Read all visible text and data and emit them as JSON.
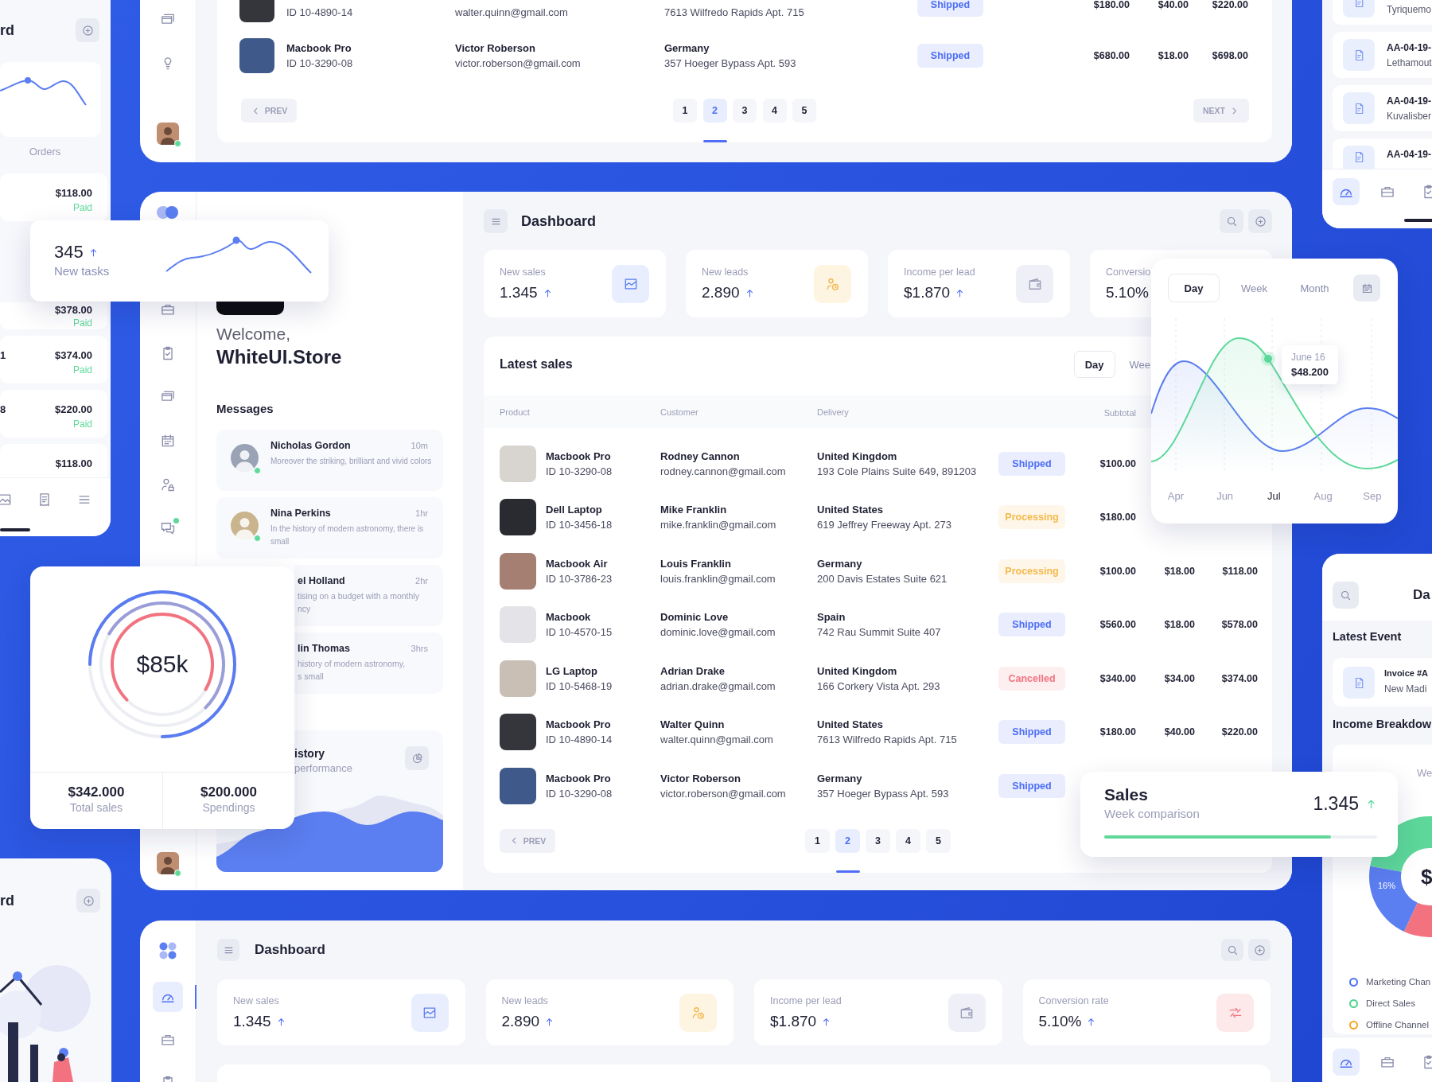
{
  "orders_card": {
    "title": "rd",
    "chart_label": "Orders",
    "orders": [
      {
        "amount": "$118.00",
        "status": "Paid"
      },
      {
        "amount": "$378.00",
        "status": "Paid"
      },
      {
        "ref": "1",
        "amount": "$374.00",
        "status": "Paid"
      },
      {
        "ref": "8",
        "amount": "$220.00",
        "status": "Paid"
      },
      {
        "amount": "$118.00"
      }
    ]
  },
  "top_panel": {
    "rows": [
      {
        "product_id": "ID 10-4890-14",
        "email": "walter.quinn@gmail.com",
        "address": "7613 Wilfredo Rapids Apt. 715",
        "status": {
          "label": "Shipped",
          "color": "#4d6ef5"
        },
        "subtotal": "$180.00",
        "column_6": "$40.00",
        "column_7": "$220.00"
      },
      {
        "product": "Macbook Pro",
        "product_id": "ID 10-3290-08",
        "customer": "Victor Roberson",
        "email": "victor.roberson@gmail.com",
        "country": "Germany",
        "address": "357 Hoeger Bypass Apt. 593",
        "status": {
          "label": "Shipped",
          "color": "#4d6ef5"
        },
        "subtotal": "$680.00",
        "column_6": "$18.00",
        "column_7": "$698.00"
      }
    ],
    "pagination": {
      "prev": "PREV",
      "pages": [
        {
          "label": "1",
          "selected": false
        },
        {
          "label": "2",
          "selected": true
        },
        {
          "label": "3",
          "selected": false
        },
        {
          "label": "4",
          "selected": false
        },
        {
          "label": "5",
          "selected": false
        }
      ],
      "next": "NEXT"
    },
    "user": {
      "online": true
    }
  },
  "invoices_card": {
    "items": [
      {
        "subtitle": "Tyriquemo"
      },
      {
        "title": "AA-04-19-",
        "subtitle": "Lethamout"
      },
      {
        "title": "AA-04-19-",
        "subtitle": "Kuvalisber"
      },
      {
        "title": "AA-04-19-"
      }
    ],
    "nav": [
      {
        "selected": true
      },
      {
        "selected": false
      },
      {
        "selected": false
      }
    ]
  },
  "tasks_card": {
    "value": "345",
    "rising": true,
    "label": "New tasks"
  },
  "main_panel": {
    "nav": [
      {
        "notification": false
      },
      {
        "notification": false
      },
      {
        "notification": false
      },
      {
        "notification": false
      },
      {
        "notification": false
      },
      {
        "notification": true
      }
    ],
    "user": {
      "online": true
    },
    "welcome": {
      "greeting": "Welcome,",
      "name": "WhiteUI.Store"
    },
    "messages": {
      "title": "Messages",
      "items": [
        {
          "kind": "full",
          "name": "Nicholas Gordon",
          "time": "10m",
          "text": "Moreover the striking, brilliant and vivid colors",
          "avatar": {
            "online": true
          }
        },
        {
          "kind": "full",
          "name": "Nina Perkins",
          "time": "1hr",
          "text": "In the history of modern astronomy, there is small",
          "avatar": {
            "online": true
          }
        },
        {
          "kind": "clipped",
          "name": "el Holland",
          "time": "2hr",
          "lines": [
            "tising on a budget with a monthly",
            "ncy"
          ]
        },
        {
          "kind": "clipped",
          "name": "lin Thomas",
          "time": "3hrs",
          "lines": [
            "history of modern astronomy,",
            "s small"
          ]
        }
      ]
    },
    "history": {
      "title": "istory",
      "subtitle": "performance"
    },
    "title": "Dashboard",
    "stats": [
      {
        "kind": "sales",
        "label": "New sales",
        "value": "1.345",
        "rising": true
      },
      {
        "kind": "leads",
        "label": "New leads",
        "value": "2.890",
        "rising": true
      },
      {
        "kind": "income",
        "label": "Income per lead",
        "value": "$1.870",
        "rising": true
      },
      {
        "kind": "plain",
        "label": "Conversio",
        "value": "5.10%"
      }
    ],
    "sales": {
      "title": "Latest sales",
      "tabs": [
        {
          "label": "Day",
          "selected": true
        },
        {
          "label": "Wee",
          "selected": false
        }
      ],
      "columns": [
        "Product",
        "Customer",
        "Delivery",
        "Subtotal"
      ],
      "rows": [
        {
          "product": "Macbook Pro",
          "product_id": "ID 10-3290-08",
          "customer": "Rodney Cannon",
          "email": "rodney.cannon@gmail.com",
          "country": "United Kingdom",
          "address": "193 Cole Plains Suite 649, 891203",
          "status": {
            "label": "Shipped",
            "color": "#4d6ef5"
          },
          "subtotal": "$100.00"
        },
        {
          "product": "Dell Laptop",
          "product_id": "ID 10-3456-18",
          "customer": "Mike Franklin",
          "email": "mike.franklin@gmail.com",
          "country": "United States",
          "address": "619 Jeffrey Freeway Apt. 273",
          "status": {
            "label": "Processing",
            "color": "#f5b94a"
          },
          "subtotal": "$180.00"
        },
        {
          "product": "Macbook Air",
          "product_id": "ID 10-3786-23",
          "customer": "Louis Franklin",
          "email": "louis.franklin@gmail.com",
          "country": "Germany",
          "address": "200 Davis Estates Suite 621",
          "status": {
            "label": "Processing",
            "color": "#f5b94a"
          },
          "subtotal": "$100.00",
          "column_6": "$18.00",
          "column_7": "$118.00"
        },
        {
          "product": "Macbook",
          "product_id": "ID 10-4570-15",
          "customer": "Dominic Love",
          "email": "dominic.love@gmail.com",
          "country": "Spain",
          "address": "742 Rau Summit Suite 407",
          "status": {
            "label": "Shipped",
            "color": "#4d6ef5"
          },
          "subtotal": "$560.00",
          "column_6": "$18.00",
          "column_7": "$578.00"
        },
        {
          "product": "LG Laptop",
          "product_id": "ID 10-5468-19",
          "customer": "Adrian Drake",
          "email": "adrian.drake@gmail.com",
          "country": "United Kingdom",
          "address": "166 Corkery Vista Apt. 293",
          "status": {
            "label": "Cancelled",
            "color": "#f2737f"
          },
          "subtotal": "$340.00",
          "column_6": "$34.00",
          "column_7": "$374.00"
        },
        {
          "product": "Macbook Pro",
          "product_id": "ID 10-4890-14",
          "customer": "Walter Quinn",
          "email": "walter.quinn@gmail.com",
          "country": "United States",
          "address": "7613 Wilfredo Rapids Apt. 715",
          "status": {
            "label": "Shipped",
            "color": "#4d6ef5"
          },
          "subtotal": "$180.00",
          "column_6": "$40.00",
          "column_7": "$220.00"
        },
        {
          "product": "Macbook Pro",
          "product_id": "ID 10-3290-08",
          "customer": "Victor Roberson",
          "email": "victor.roberson@gmail.com",
          "country": "Germany",
          "address": "357 Hoeger Bypass Apt. 593",
          "status": {
            "label": "Shipped",
            "color": "#4d6ef5"
          }
        }
      ],
      "pagination": {
        "prev": "PREV",
        "pages": [
          {
            "label": "1",
            "selected": false
          },
          {
            "label": "2",
            "selected": true
          },
          {
            "label": "3",
            "selected": false
          },
          {
            "label": "4",
            "selected": false
          },
          {
            "label": "5",
            "selected": false
          }
        ]
      }
    }
  },
  "trend_card": {
    "tabs": [
      {
        "label": "Day",
        "selected": true
      },
      {
        "label": "Week",
        "selected": false
      },
      {
        "label": "Month",
        "selected": false
      }
    ],
    "tooltip": {
      "date": "June 16",
      "value": "$48.200"
    },
    "x_labels": [
      {
        "label": "Apr",
        "selected": false
      },
      {
        "label": "Jun",
        "selected": false
      },
      {
        "label": "Jul",
        "selected": true
      },
      {
        "label": "Aug",
        "selected": false
      },
      {
        "label": "Sep",
        "selected": false
      }
    ]
  },
  "revenue_card": {
    "value": "$85k",
    "stats": [
      {
        "value": "$342.000",
        "label": "Total sales"
      },
      {
        "value": "$200.000",
        "label": "Spendings"
      }
    ]
  },
  "sales_card": {
    "title": "Sales",
    "subtitle": "Week comparison",
    "value": "1.345",
    "rising": true,
    "level": 0.83
  },
  "events_card": {
    "title": "Da",
    "section_title": "Latest Event",
    "events": [
      {
        "title": "Invoice #A",
        "subtitle": "New Madi"
      }
    ],
    "breakdown": {
      "title": "Income Breakdow",
      "tab": "We",
      "center": "$",
      "slice_label": "16%",
      "legend": [
        {
          "label": "Marketing Chan",
          "color": "#4d6ef5"
        },
        {
          "label": "Direct Sales",
          "color": "#4cd48a"
        },
        {
          "label": "Offline Channel",
          "color": "#f5a623"
        }
      ]
    },
    "nav": [
      {
        "selected": true
      },
      {
        "selected": false
      },
      {
        "selected": false
      }
    ]
  },
  "illustration_card": {
    "title": "rd"
  },
  "bottom_panel": {
    "nav": [
      {
        "selected": true
      },
      {
        "selected": false
      },
      {
        "selected": false
      }
    ],
    "title": "Dashboard",
    "stats": [
      {
        "kind": "sales",
        "label": "New sales",
        "value": "1.345",
        "rising": true
      },
      {
        "kind": "leads",
        "label": "New leads",
        "value": "2.890",
        "rising": true
      },
      {
        "kind": "income",
        "label": "Income per lead",
        "value": "$1.870",
        "rising": true
      },
      {
        "kind": "conversion",
        "label": "Conversion rate",
        "value": "5.10%",
        "rising": true
      }
    ]
  }
}
